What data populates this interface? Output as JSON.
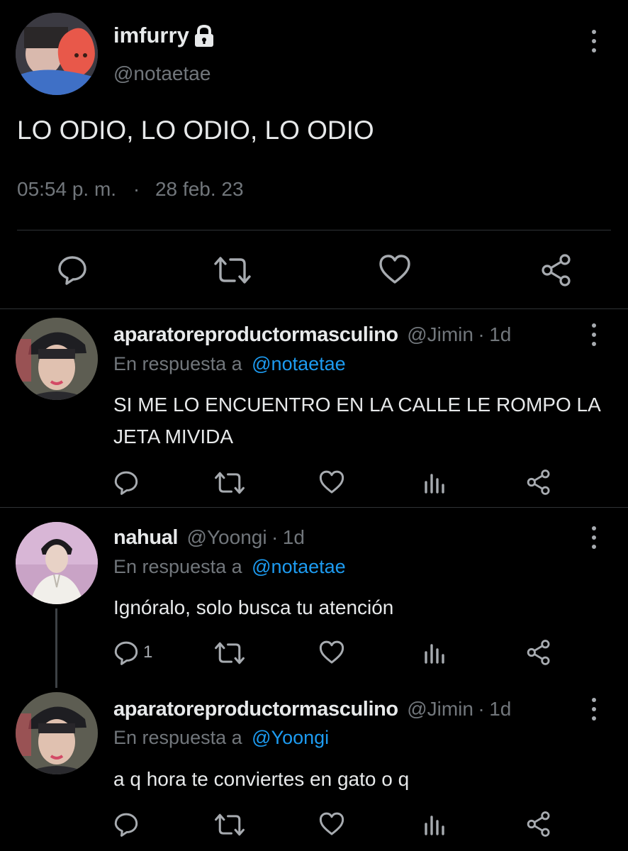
{
  "main_tweet": {
    "display_name": "imfurry",
    "handle": "@notaetae",
    "text": "LO ODIO, LO ODIO, LO ODIO",
    "time": "05:54 p. m.",
    "separator": "·",
    "date": "28 feb. 23"
  },
  "replies": [
    {
      "display_name": "aparatoreproductormasculino",
      "handle": "@Jimin",
      "separator": "·",
      "age": "1d",
      "reply_prefix": "En respuesta a",
      "reply_to": "@notaetae",
      "text": "SI ME LO ENCUENTRO EN LA CALLE LE ROMPO LA JETA MIVIDA",
      "reply_count": ""
    },
    {
      "display_name": "nahual",
      "handle": "@Yoongi",
      "separator": "·",
      "age": "1d",
      "reply_prefix": "En respuesta a",
      "reply_to": "@notaetae",
      "text": "Ignóralo, solo busca tu atención",
      "reply_count": "1"
    },
    {
      "display_name": "aparatoreproductormasculino",
      "handle": "@Jimin",
      "separator": "·",
      "age": "1d",
      "reply_prefix": "En respuesta a",
      "reply_to": "@Yoongi",
      "text": "a q hora te conviertes en gato o q",
      "reply_count": ""
    }
  ],
  "icons": {
    "reply": "speech-bubble-icon",
    "retweet": "retweet-arrows-icon",
    "like": "heart-icon",
    "views": "bar-chart-icon",
    "share": "share-nodes-icon",
    "more": "vertical-ellipsis-icon",
    "protected": "lock-icon"
  },
  "colors": {
    "background": "#000000",
    "text": "#e7e9ea",
    "muted": "#71767b",
    "link": "#1d9bf0",
    "divider": "#2f3336"
  }
}
